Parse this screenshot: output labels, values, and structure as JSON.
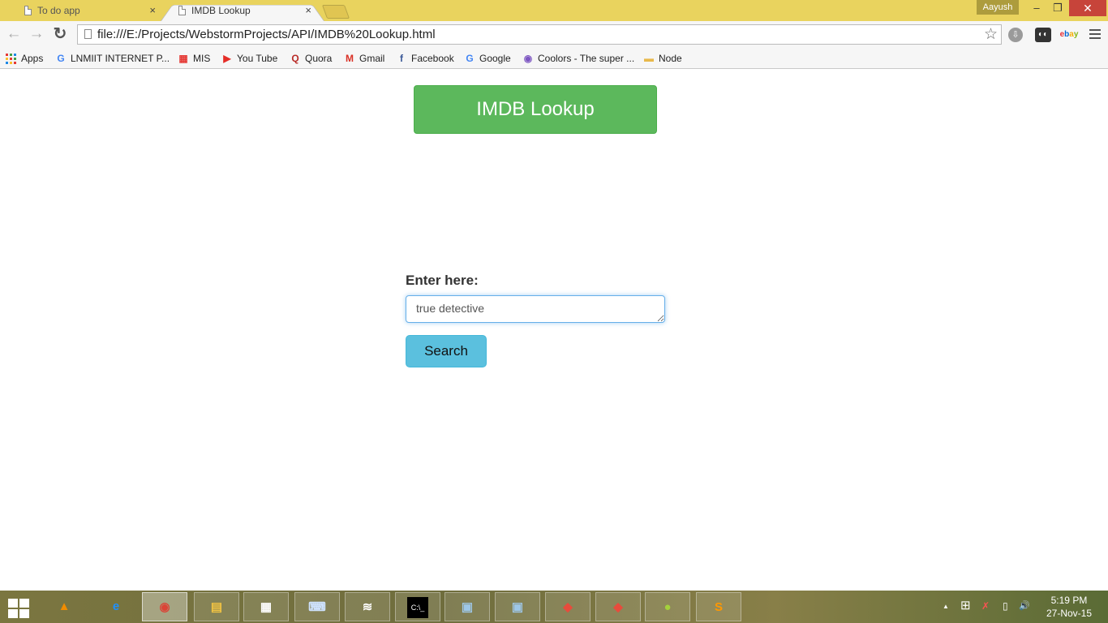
{
  "browser": {
    "tabs": [
      {
        "title": "To do app",
        "close": "×",
        "active": false
      },
      {
        "title": "IMDB Lookup",
        "close": "×",
        "active": true
      }
    ],
    "profile_name": "Aayush",
    "window_controls": {
      "minimize": "–",
      "restore": "❐",
      "close": "✕"
    },
    "nav": {
      "back": "←",
      "forward": "→",
      "reload": "↻"
    },
    "url": "file:///E:/Projects/WebstormProjects/API/IMDB%20Lookup.html",
    "bookmark_star": "☆",
    "extensions": {
      "download": "⇩",
      "glasses": "◐◐",
      "ebay": [
        "e",
        "b",
        "a",
        "y"
      ]
    }
  },
  "bookmarks": [
    {
      "label": "Apps",
      "icon": "apps-grid-icon"
    },
    {
      "label": "LNMIIT INTERNET P...",
      "icon": "google-icon",
      "glyph": "G",
      "color": "#4285f4"
    },
    {
      "label": "MIS",
      "icon": "mis-icon",
      "glyph": "▦",
      "color": "#e53935"
    },
    {
      "label": "You Tube",
      "icon": "youtube-icon",
      "glyph": "▶",
      "color": "#e52d27"
    },
    {
      "label": "Quora",
      "icon": "quora-icon",
      "glyph": "Q",
      "color": "#b92b27"
    },
    {
      "label": "Gmail",
      "icon": "gmail-icon",
      "glyph": "M",
      "color": "#d93025"
    },
    {
      "label": "Facebook",
      "icon": "facebook-icon",
      "glyph": "f",
      "color": "#3b5998"
    },
    {
      "label": "Google",
      "icon": "google-icon",
      "glyph": "G",
      "color": "#4285f4"
    },
    {
      "label": "Coolors - The super ...",
      "icon": "coolors-icon",
      "glyph": "◉",
      "color": "#7d56c2"
    },
    {
      "label": "Node",
      "icon": "folder-icon",
      "glyph": "▬",
      "color": "#e8b84b"
    }
  ],
  "page": {
    "header_button": "IMDB Lookup",
    "form_label": "Enter here:",
    "search_value": "true detective",
    "search_button": "Search"
  },
  "taskbar": {
    "apps": [
      {
        "name": "vlc",
        "glyph": "▲",
        "color": "#f08c00"
      },
      {
        "name": "internet-explorer",
        "glyph": "e",
        "color": "#1e90ff"
      },
      {
        "name": "chrome",
        "glyph": "◉",
        "color": "#db4437"
      },
      {
        "name": "file-explorer",
        "glyph": "▤",
        "color": "#f4c542"
      },
      {
        "name": "app-grid",
        "glyph": "▦",
        "color": "#ffffff"
      },
      {
        "name": "keyboard",
        "glyph": "⌨",
        "color": "#cfe3ff"
      },
      {
        "name": "wifi-hotspot",
        "glyph": "≋",
        "color": "#ffffff"
      },
      {
        "name": "command-prompt",
        "glyph": "C:\\_",
        "color": "#ffffff"
      },
      {
        "name": "document-1",
        "glyph": "▣",
        "color": "#9ec7e8"
      },
      {
        "name": "document-2",
        "glyph": "▣",
        "color": "#9ec7e8"
      },
      {
        "name": "app-diamond-1",
        "glyph": "◆",
        "color": "#e84b3c"
      },
      {
        "name": "app-diamond-2",
        "glyph": "◆",
        "color": "#e84b3c"
      },
      {
        "name": "app-balls",
        "glyph": "●",
        "color": "#a4d13b"
      },
      {
        "name": "sublime-text",
        "glyph": "S",
        "color": "#ff9800"
      }
    ],
    "tray": {
      "arrow": "▲",
      "windows": "⊞",
      "network": "✗",
      "battery": "▯",
      "volume": "🔊"
    },
    "time": "5:19 PM",
    "date": "27-Nov-15"
  }
}
